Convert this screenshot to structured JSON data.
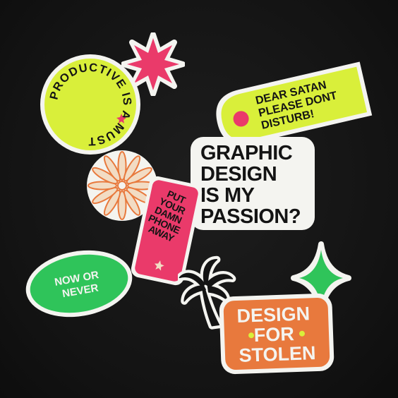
{
  "colors": {
    "background": "#141414",
    "lime": "#d9ef3a",
    "pink": "#ea3a6a",
    "green": "#2fc45a",
    "orange": "#e8793d",
    "sticker_white": "#f4f4f0",
    "ink": "#141414",
    "peach": "#f2dcc4"
  },
  "stickers": {
    "productive": {
      "text": "PRODUCTIVE IS A MUST"
    },
    "dear_satan": {
      "lines": [
        "DEAR SATAN",
        "PLEASE DONT",
        "DISTURB!"
      ]
    },
    "graphic_design": {
      "lines": [
        "GRAPHIC",
        "DESIGN",
        "IS MY",
        "PASSION?"
      ]
    },
    "phone": {
      "lines": [
        "PUT",
        "YOUR",
        "DAMN",
        "PHONE",
        "AWAY"
      ]
    },
    "now_or_never": {
      "lines": [
        "NOW OR",
        "NEVER"
      ]
    },
    "design_for_stolen": {
      "lines": [
        "DESIGN",
        "FOR",
        "STOLEN"
      ]
    }
  },
  "icons": [
    "pink-starburst-icon",
    "daisy-flower-icon",
    "palm-tree-icon",
    "green-sparkle-icon"
  ]
}
